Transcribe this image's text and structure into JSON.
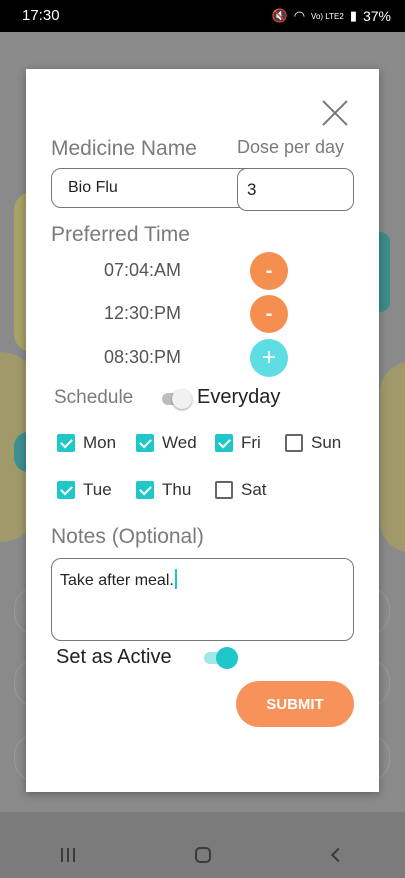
{
  "status_bar": {
    "time": "17:30",
    "network": "Vo) LTE2",
    "battery": "37%"
  },
  "form": {
    "medicine_name_label": "Medicine Name",
    "medicine_name_value": "Bio Flu",
    "dose_label": "Dose per day",
    "dose_value": "3",
    "preferred_time_label": "Preferred Time",
    "times": [
      {
        "time": "07:04:AM",
        "button": "-"
      },
      {
        "time": "12:30:PM",
        "button": "-"
      },
      {
        "time": "08:30:PM",
        "button": "+"
      }
    ],
    "schedule_label": "Schedule",
    "schedule_value": "Everyday",
    "schedule_everyday_toggle": false,
    "days": [
      {
        "label": "Mon",
        "checked": true
      },
      {
        "label": "Wed",
        "checked": true
      },
      {
        "label": "Fri",
        "checked": true
      },
      {
        "label": "Sun",
        "checked": false
      },
      {
        "label": "Tue",
        "checked": true
      },
      {
        "label": "Thu",
        "checked": true
      },
      {
        "label": "Sat",
        "checked": false
      }
    ],
    "notes_label": "Notes (Optional)",
    "notes_value": "Take after meal.",
    "active_label": "Set as Active",
    "active_toggle": true,
    "submit_label": "SUBMIT"
  },
  "colors": {
    "accent_teal": "#20c7c8",
    "accent_orange": "#f58f4f",
    "plus_button": "#5fdde5"
  }
}
